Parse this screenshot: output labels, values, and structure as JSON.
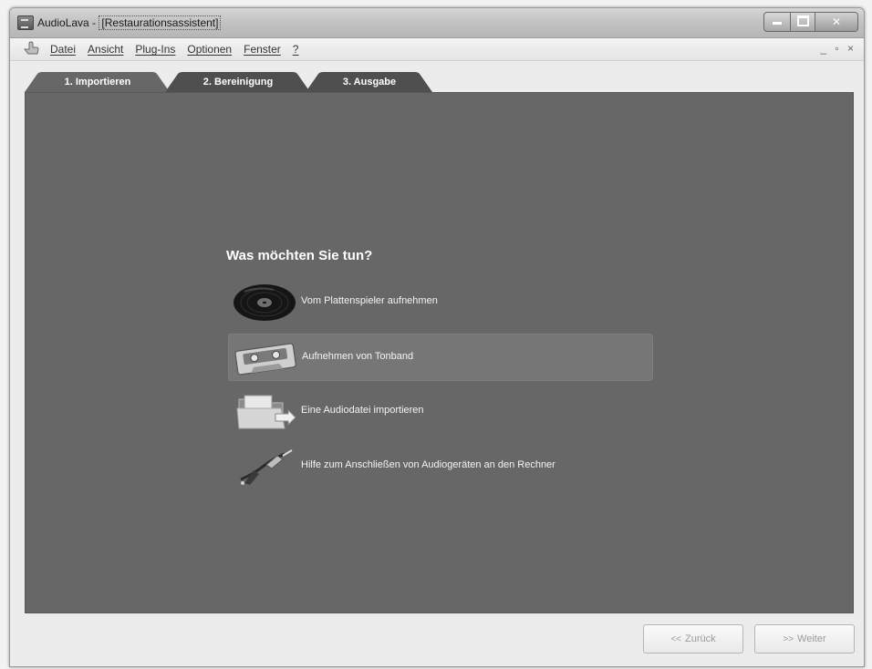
{
  "window": {
    "app_name": "AudioLava - ",
    "document_title": "[Restaurationsassistent]"
  },
  "menu": {
    "items": [
      "Datei",
      "Ansicht",
      "Plug-Ins",
      "Optionen",
      "Fenster",
      "?"
    ],
    "mdi_controls": "_ ▫ ×"
  },
  "tabs": [
    {
      "label": "1. Importieren",
      "active": true
    },
    {
      "label": "2. Bereinigung",
      "active": false
    },
    {
      "label": "3. Ausgabe",
      "active": false
    }
  ],
  "main": {
    "question": "Was möchten Sie tun?",
    "options": [
      {
        "label": "Vom Plattenspieler aufnehmen",
        "icon": "vinyl-record-icon",
        "selected": false
      },
      {
        "label": "Aufnehmen von Tonband",
        "icon": "cassette-tape-icon",
        "selected": true
      },
      {
        "label": "Eine Audiodatei importieren",
        "icon": "folder-import-icon",
        "selected": false
      },
      {
        "label": "Hilfe zum Anschließen von Audiogeräten an den Rechner",
        "icon": "audio-cable-icon",
        "selected": false
      }
    ]
  },
  "footer": {
    "back_label": "Zurück",
    "next_label": "Weiter",
    "back_arrow": "<<",
    "next_arrow": ">>"
  },
  "colors": {
    "content_bg": "#676767",
    "tab_bg": "#505050",
    "selected_option_bg": "#767676"
  }
}
